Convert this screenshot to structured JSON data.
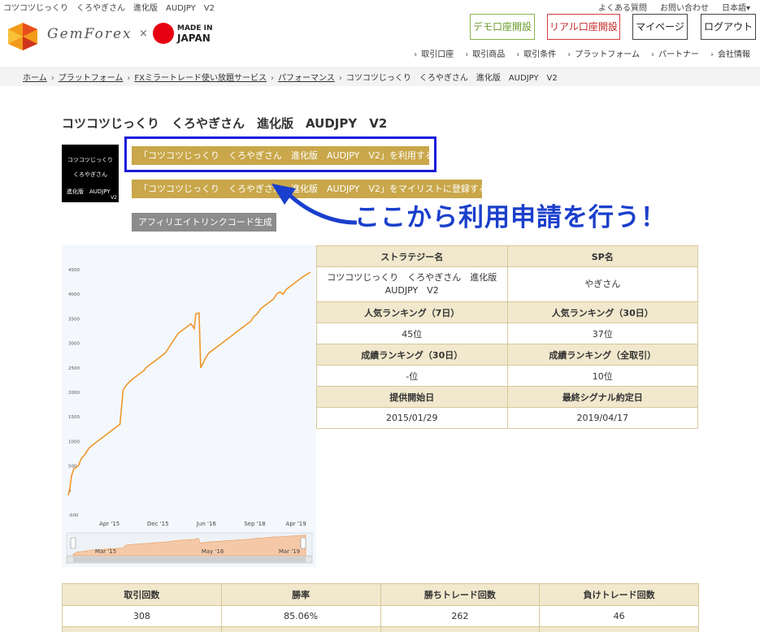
{
  "window": {
    "page_name": "コツコツじっくり　くろやぎさん　進化版　AUDJPY　V2"
  },
  "top_links": [
    "よくある質問",
    "お問い合わせ",
    "日本語▾"
  ],
  "logo": {
    "brand": "GemForex",
    "times": "×",
    "made_in": "MADE IN",
    "japan": "JAPAN"
  },
  "header_buttons": {
    "demo": "デモ口座開設",
    "real": "リアル口座開設",
    "mypage": "マイページ",
    "logout": "ログアウト"
  },
  "subnav": [
    "取引口座",
    "取引商品",
    "取引条件",
    "プラットフォーム",
    "パートナー",
    "会社情報"
  ],
  "breadcrumb": {
    "links": [
      "ホーム",
      "プラットフォーム",
      "FXミラートレード使い放題サービス",
      "パフォーマンス"
    ],
    "current": "コツコツじっくり　くろやぎさん　進化版　AUDJPY　V2",
    "separator": "›"
  },
  "title": "コツコツじっくり　くろやぎさん　進化版　AUDJPY　V2",
  "thumbnail": {
    "line1": "コツコツじっくり",
    "line2": "くろやぎさん",
    "line3": "進化版　AUDJPY",
    "line4": "V2"
  },
  "actions": {
    "use": "「コツコツじっくり　くろやぎさん　進化版　AUDJPY　V2」を利用する",
    "mylist": "「コツコツじっくり　くろやぎさん　進化版　AUDJPY　V2」をマイリストに登録する",
    "affiliate": "アフィリエイトリンクコード生成"
  },
  "annotation": {
    "text": "ここから利用申請を行う！",
    "color": "#1a3fcc"
  },
  "info": {
    "rows": [
      {
        "type": "header",
        "cells": [
          "ストラテジー名",
          "SP名"
        ]
      },
      {
        "type": "value",
        "cells": [
          "コツコツじっくり　くろやぎさん　進化版 AUDJPY　V2",
          "やぎさん"
        ]
      },
      {
        "type": "header",
        "cells": [
          "人気ランキング（7日）",
          "人気ランキング（30日）"
        ]
      },
      {
        "type": "value",
        "cells": [
          "45位",
          "37位"
        ]
      },
      {
        "type": "header",
        "cells": [
          "成績ランキング（30日）",
          "成績ランキング（全取引）"
        ]
      },
      {
        "type": "value",
        "cells": [
          "-位",
          "10位"
        ]
      },
      {
        "type": "header",
        "cells": [
          "提供開始日",
          "最終シグナル約定日"
        ]
      },
      {
        "type": "value",
        "cells": [
          "2015/01/29",
          "2019/04/17"
        ]
      }
    ]
  },
  "stats": {
    "headers": [
      "取引回数",
      "勝率",
      "勝ちトレード回数",
      "負けトレード回数"
    ],
    "values": [
      "308",
      "85.06%",
      "262",
      "46"
    ]
  },
  "colors": {
    "gold_button": "#c9a74a",
    "table_header": "#f1e8cd",
    "table_border": "#d6c89b",
    "line": "#f0962a",
    "highlight": "#1a1adc"
  },
  "chart_data": {
    "type": "line",
    "ylim": [
      -500,
      4600
    ],
    "y_ticks": [
      -500,
      0,
      500,
      1000,
      1500,
      2000,
      2500,
      3000,
      3500,
      4000,
      4500
    ],
    "x_tick_labels": [
      "Apr '15",
      "Dec '15",
      "Jun '16",
      "Sep '18",
      "Apr '19"
    ],
    "navigator_labels": [
      "Mar '15",
      "May '16",
      "Mar '19"
    ],
    "series": [
      {
        "x": [
          0,
          2,
          4,
          7,
          10,
          13,
          16,
          20,
          25,
          28,
          32,
          36,
          40,
          44,
          48,
          52,
          56,
          60,
          64,
          68,
          72,
          78,
          82,
          86,
          90,
          94,
          96,
          100,
          104,
          108,
          112,
          116,
          120,
          124,
          128,
          132,
          136,
          140,
          144,
          148,
          152,
          156,
          158,
          162,
          164,
          167,
          170,
          174,
          178,
          182,
          186,
          190,
          194,
          198,
          202,
          206,
          210,
          214,
          218,
          222,
          226,
          230,
          234,
          238,
          242,
          246,
          250,
          254,
          258,
          262,
          266,
          270,
          274,
          278,
          282,
          286,
          290,
          295,
          300
        ],
        "y": [
          -100,
          50,
          300,
          450,
          470,
          520,
          650,
          720,
          850,
          900,
          950,
          1000,
          1050,
          1100,
          1150,
          1200,
          1250,
          1300,
          1350,
          2050,
          2150,
          2250,
          2300,
          2350,
          2400,
          2450,
          2500,
          2550,
          2600,
          2650,
          2700,
          2750,
          2800,
          2900,
          3000,
          3100,
          3200,
          3250,
          3300,
          3350,
          3400,
          3300,
          3600,
          3620,
          2500,
          2600,
          2700,
          2800,
          2850,
          2900,
          2950,
          3000,
          3050,
          3100,
          3150,
          3200,
          3250,
          3300,
          3350,
          3400,
          3450,
          3550,
          3600,
          3700,
          3750,
          3800,
          3850,
          3900,
          4000,
          4050,
          4000,
          4100,
          4150,
          4200,
          4250,
          4300,
          4350,
          4400,
          4450
        ]
      }
    ]
  }
}
